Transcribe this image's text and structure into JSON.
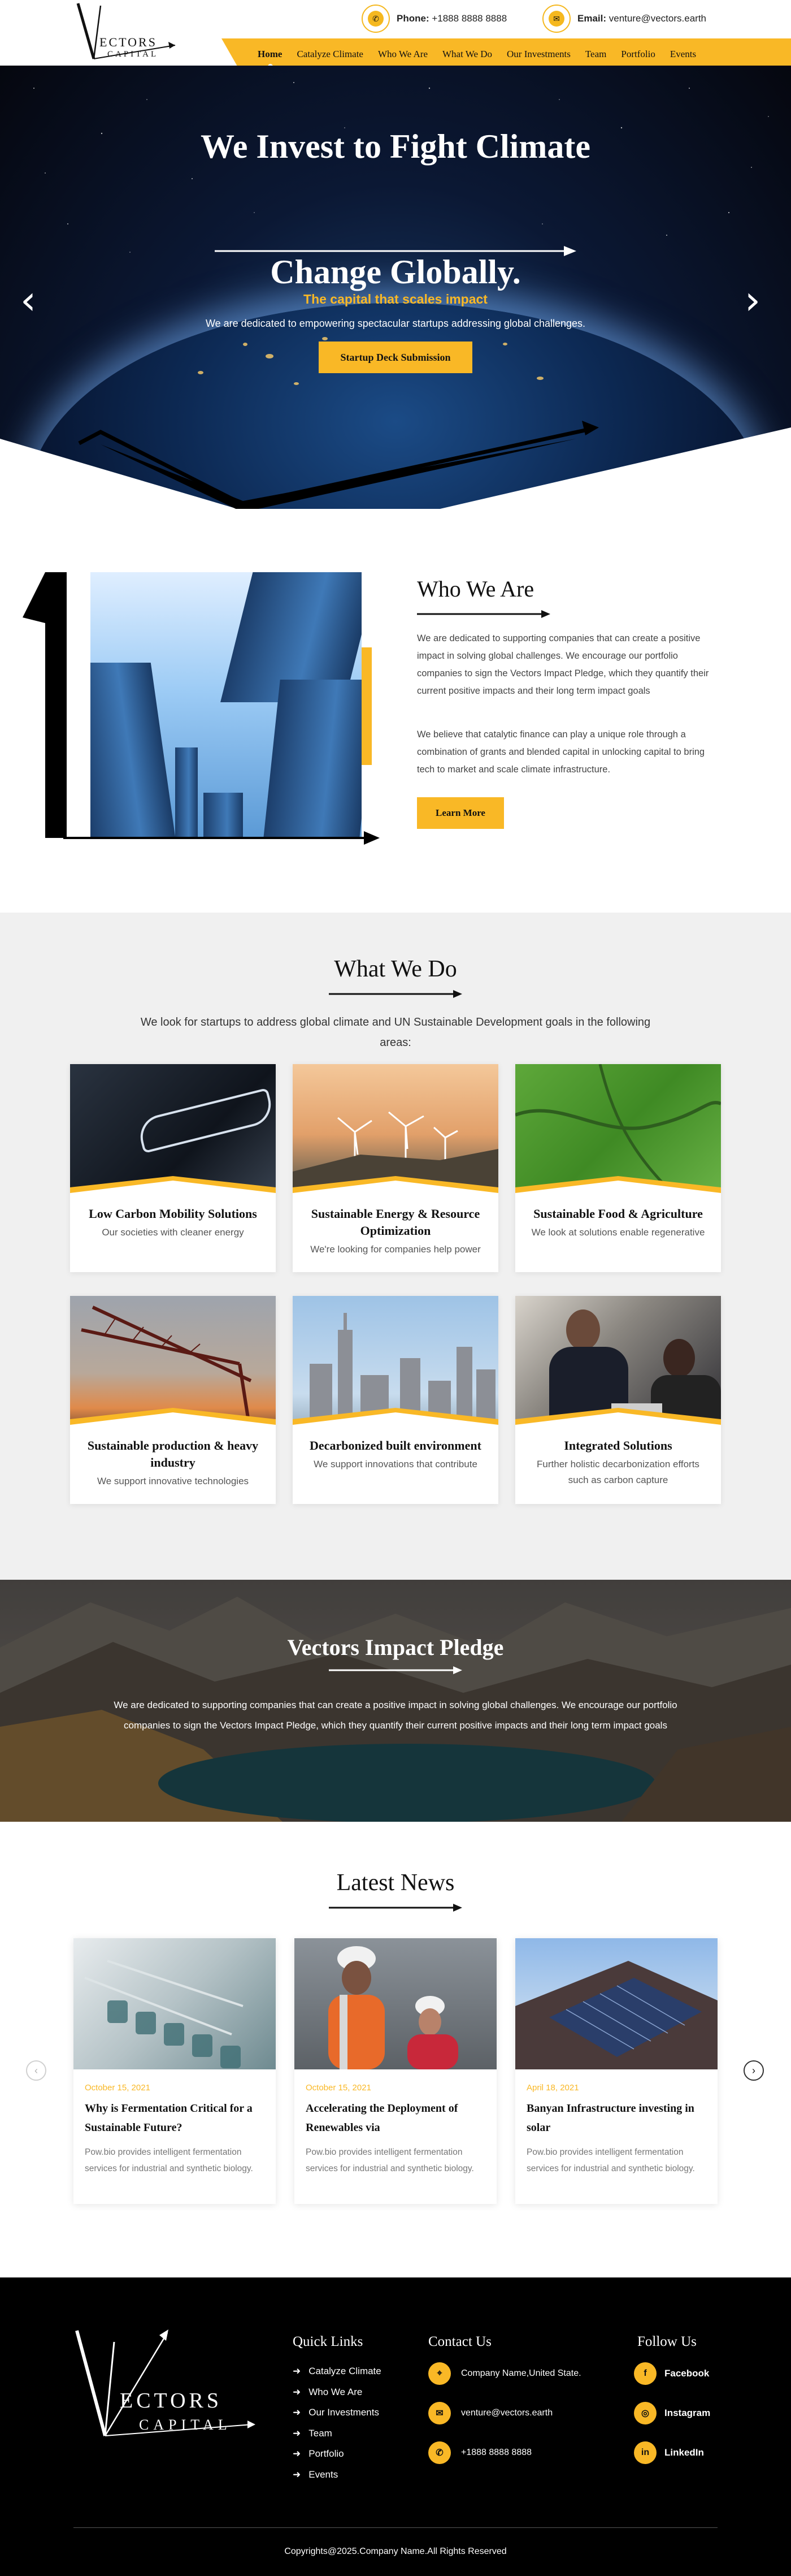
{
  "header": {
    "logo": {
      "line1": "ECTORS",
      "line2": "CAPITAL"
    },
    "phone": {
      "label": "Phone:",
      "value": "+1888 8888 8888"
    },
    "email": {
      "label": "Email:",
      "value": "venture@vectors.earth"
    },
    "nav": [
      "Home",
      "Catalyze Climate",
      "Who We Are",
      "What We Do",
      "Our Investments",
      "Team",
      "Portfolio",
      "Events"
    ]
  },
  "hero": {
    "title_line1": "We Invest to Fight Climate",
    "title_line2": "Change Globally.",
    "tagline": "The capital that scales impact",
    "subtitle": "We are dedicated to empowering spectacular startups addressing global challenges.",
    "button": "Startup Deck Submission"
  },
  "who": {
    "title": "Who We Are",
    "para1": "We are dedicated to supporting companies that can create a positive impact in solving global challenges. We encourage our portfolio companies to sign the Vectors Impact Pledge, which they quantify their current positive impacts and their long term impact goals",
    "para2": "We believe that catalytic finance can play a unique role through a combination of grants and blended capital in unlocking capital to bring tech to market and scale climate infrastructure.",
    "button": "Learn More"
  },
  "what": {
    "title": "What We Do",
    "intro": "We look for startups to address global climate and UN Sustainable Development goals in the following areas:",
    "cards": [
      {
        "title": "Low Carbon Mobility Solutions",
        "text": "Our societies with cleaner energy"
      },
      {
        "title": "Sustainable Energy & Resource Optimization",
        "text": "We're looking for companies help power"
      },
      {
        "title": "Sustainable Food & Agriculture",
        "text": "We look at solutions enable regenerative"
      },
      {
        "title": "Sustainable production & heavy industry",
        "text": "We support innovative technologies"
      },
      {
        "title": "Decarbonized built environment",
        "text": "We support innovations that contribute"
      },
      {
        "title": "Integrated Solutions",
        "text": "Further holistic decarbonization efforts such as carbon capture"
      }
    ]
  },
  "pledge": {
    "title": "Vectors Impact Pledge",
    "text": "We are dedicated to supporting companies that can create a positive impact in solving global challenges. We encourage our portfolio companies to sign the Vectors Impact Pledge, which they quantify their current positive impacts and their long term impact goals"
  },
  "news": {
    "title": "Latest News",
    "items": [
      {
        "date": "October 15, 2021",
        "title": "Why is Fermentation Critical for a Sustainable Future?",
        "text": "Pow.bio provides intelligent fermentation services for industrial and synthetic biology."
      },
      {
        "date": "October 15, 2021",
        "title": "Accelerating the Deployment of Renewables via",
        "text": "Pow.bio provides intelligent fermentation services for industrial and synthetic biology."
      },
      {
        "date": "April 18, 2021",
        "title": "Banyan Infrastructure investing in solar",
        "text": "Pow.bio provides intelligent fermentation services for industrial and synthetic biology."
      }
    ]
  },
  "footer": {
    "logo": {
      "line1": "ECTORS",
      "line2": "CAPITAL"
    },
    "quick_title": "Quick Links",
    "quick_links": [
      "Catalyze Climate",
      "Who We Are",
      "Our Investments",
      "Team",
      "Portfolio",
      "Events"
    ],
    "contact_title": "Contact Us",
    "address": "Company Name,United State.",
    "email": "venture@vectors.earth",
    "phone": "+1888 8888 8888",
    "follow_title": "Follow Us",
    "social": [
      "Facebook",
      "Instagram",
      "LinkedIn"
    ],
    "copyright": "Copyrights@2025.Company Name.All Rights Reserved"
  },
  "colors": {
    "accent": "#f9b826",
    "dark": "#000000",
    "section_bg": "#f0f0f0"
  },
  "icons": [
    "phone-icon",
    "mail-icon",
    "chevron-left-icon",
    "chevron-right-icon",
    "map-pin-icon",
    "facebook-icon",
    "instagram-icon",
    "linkedin-icon",
    "arrow-right-icon"
  ]
}
